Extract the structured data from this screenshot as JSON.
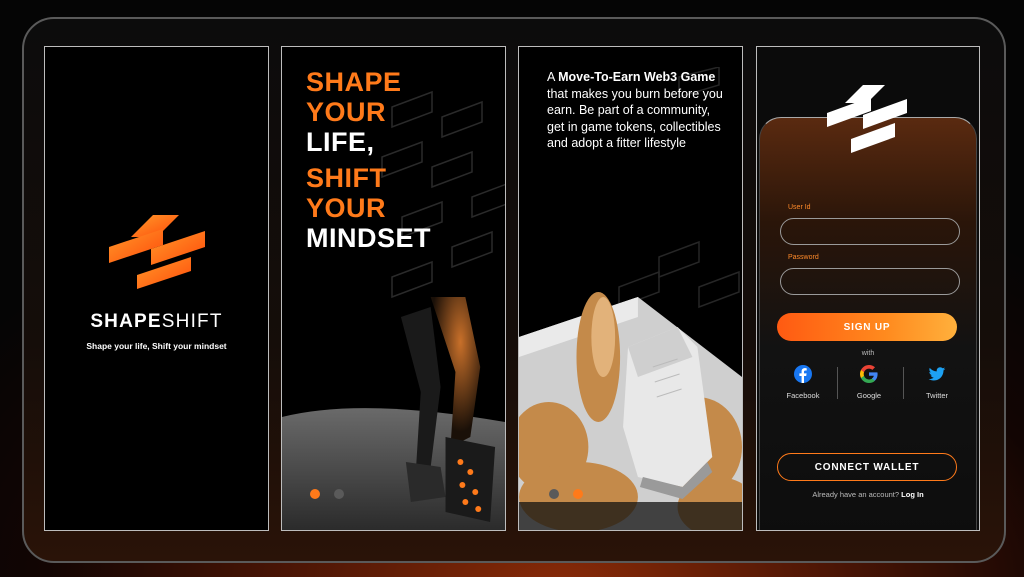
{
  "splash": {
    "brand_bold": "SHAPE",
    "brand_light": "SHIFT",
    "tagline": "Shape your life, Shift your mindset"
  },
  "onboarding_1": {
    "line1": "SHAPE",
    "line2": "YOUR",
    "line3": "LIFE,",
    "line4": "SHIFT",
    "line5": "YOUR",
    "line6": "MINDSET",
    "active_dot": 1
  },
  "onboarding_2": {
    "t1": "A ",
    "t2": "Move-To-Earn Web3 Game",
    "t3": " that makes you burn before you earn. Be part of a community, get in game tokens, collectibles and adopt a fitter lifestyle",
    "active_dot": 2
  },
  "login": {
    "userid_label": "User Id",
    "password_label": "Password",
    "signup_label": "SIGN UP",
    "with_label": "with",
    "social": [
      {
        "label": "Facebook",
        "icon": "facebook-icon"
      },
      {
        "label": "Google",
        "icon": "google-icon"
      },
      {
        "label": "Twitter",
        "icon": "twitter-icon"
      }
    ],
    "connect_label": "CONNECT WALLET",
    "already_text": "Already have an account?",
    "login_link": "Log In"
  },
  "colors": {
    "accent": "#ff7a1a",
    "facebook": "#1877f2",
    "twitter": "#1da1f2"
  }
}
